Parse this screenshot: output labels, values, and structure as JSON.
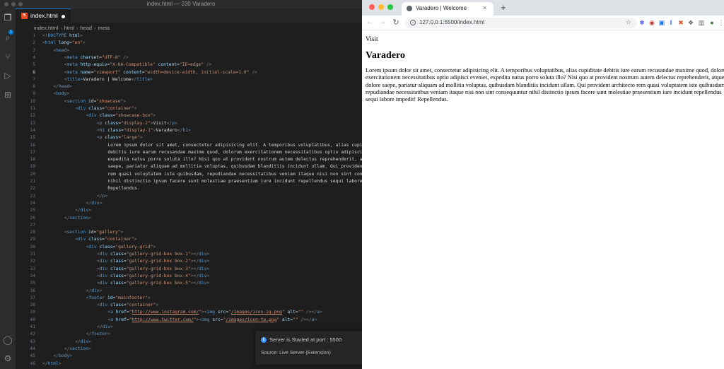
{
  "vscode": {
    "window_title": "index.html — 230 Varadero",
    "tab": {
      "icon": "html5-icon",
      "label": "index.html"
    },
    "breadcrumb": [
      "index.html",
      "html",
      "head",
      "meta"
    ],
    "current_line": 6,
    "notification": {
      "message": "Server is Started at port : 5500",
      "source": "Source: Live Server (Extension)"
    },
    "accent": "#0078d4"
  },
  "code_lines": [
    {
      "n": "1",
      "i": 0,
      "t": [
        [
          "pu",
          "<!"
        ],
        [
          "tg",
          "DOCTYPE"
        ],
        [
          "tx",
          " "
        ],
        [
          "at",
          "html"
        ],
        [
          "pu",
          ">"
        ]
      ]
    },
    {
      "n": "2",
      "i": 0,
      "t": [
        [
          "pu",
          "<"
        ],
        [
          "tg",
          "html"
        ],
        [
          "tx",
          " "
        ],
        [
          "at",
          "lang"
        ],
        [
          "tx",
          "="
        ],
        [
          "st",
          "\"en\""
        ],
        [
          "pu",
          ">"
        ]
      ]
    },
    {
      "n": "3",
      "i": 1,
      "t": [
        [
          "pu",
          "<"
        ],
        [
          "tg",
          "head"
        ],
        [
          "pu",
          ">"
        ]
      ]
    },
    {
      "n": "4",
      "i": 2,
      "t": [
        [
          "pu",
          "<"
        ],
        [
          "tg",
          "meta"
        ],
        [
          "tx",
          " "
        ],
        [
          "at",
          "charset"
        ],
        [
          "tx",
          "="
        ],
        [
          "st",
          "\"UTF-8\""
        ],
        [
          "tx",
          " "
        ],
        [
          "pu",
          "/>"
        ]
      ]
    },
    {
      "n": "5",
      "i": 2,
      "t": [
        [
          "pu",
          "<"
        ],
        [
          "tg",
          "meta"
        ],
        [
          "tx",
          " "
        ],
        [
          "at",
          "http-equiv"
        ],
        [
          "tx",
          "="
        ],
        [
          "st",
          "\"X-UA-Compatible\""
        ],
        [
          "tx",
          " "
        ],
        [
          "at",
          "content"
        ],
        [
          "tx",
          "="
        ],
        [
          "st",
          "\"IE=edge\""
        ],
        [
          "tx",
          " "
        ],
        [
          "pu",
          "/>"
        ]
      ]
    },
    {
      "n": "6",
      "i": 2,
      "t": [
        [
          "pu",
          "<"
        ],
        [
          "tg",
          "meta"
        ],
        [
          "tx",
          " "
        ],
        [
          "at",
          "name"
        ],
        [
          "tx",
          "="
        ],
        [
          "st",
          "\"viewport\""
        ],
        [
          "tx",
          " "
        ],
        [
          "at",
          "content"
        ],
        [
          "tx",
          "="
        ],
        [
          "st",
          "\"width=device-width, initial-scale=1.0\""
        ],
        [
          "tx",
          " "
        ],
        [
          "pu",
          "/>"
        ]
      ]
    },
    {
      "n": "7",
      "i": 2,
      "t": [
        [
          "pu",
          "<"
        ],
        [
          "tg",
          "title"
        ],
        [
          "pu",
          ">"
        ],
        [
          "tx",
          "Varadero | Welcome"
        ],
        [
          "pu",
          "</"
        ],
        [
          "tg",
          "title"
        ],
        [
          "pu",
          ">"
        ]
      ]
    },
    {
      "n": "8",
      "i": 1,
      "t": [
        [
          "pu",
          "</"
        ],
        [
          "tg",
          "head"
        ],
        [
          "pu",
          ">"
        ]
      ]
    },
    {
      "n": "9",
      "i": 1,
      "t": [
        [
          "pu",
          "<"
        ],
        [
          "tg",
          "body"
        ],
        [
          "pu",
          ">"
        ]
      ]
    },
    {
      "n": "10",
      "i": 2,
      "t": [
        [
          "pu",
          "<"
        ],
        [
          "tg",
          "section"
        ],
        [
          "tx",
          " "
        ],
        [
          "at",
          "id"
        ],
        [
          "tx",
          "="
        ],
        [
          "st",
          "\"showcase\""
        ],
        [
          "pu",
          ">"
        ]
      ]
    },
    {
      "n": "11",
      "i": 3,
      "t": [
        [
          "pu",
          "<"
        ],
        [
          "tg",
          "div"
        ],
        [
          "tx",
          " "
        ],
        [
          "at",
          "class"
        ],
        [
          "tx",
          "="
        ],
        [
          "st",
          "\"container\""
        ],
        [
          "pu",
          ">"
        ]
      ]
    },
    {
      "n": "12",
      "i": 4,
      "t": [
        [
          "pu",
          "<"
        ],
        [
          "tg",
          "div"
        ],
        [
          "tx",
          " "
        ],
        [
          "at",
          "class"
        ],
        [
          "tx",
          "="
        ],
        [
          "st",
          "\"showcase-box\""
        ],
        [
          "pu",
          ">"
        ]
      ]
    },
    {
      "n": "13",
      "i": 5,
      "t": [
        [
          "pu",
          "<"
        ],
        [
          "tg",
          "p"
        ],
        [
          "tx",
          " "
        ],
        [
          "at",
          "class"
        ],
        [
          "tx",
          "="
        ],
        [
          "st",
          "\"display-2\""
        ],
        [
          "pu",
          ">"
        ],
        [
          "tx",
          "Visit"
        ],
        [
          "pu",
          "</"
        ],
        [
          "tg",
          "p"
        ],
        [
          "pu",
          ">"
        ]
      ]
    },
    {
      "n": "14",
      "i": 5,
      "t": [
        [
          "pu",
          "<"
        ],
        [
          "tg",
          "h1"
        ],
        [
          "tx",
          " "
        ],
        [
          "at",
          "class"
        ],
        [
          "tx",
          "="
        ],
        [
          "st",
          "\"display-1\""
        ],
        [
          "pu",
          ">"
        ],
        [
          "tx",
          "Varadero"
        ],
        [
          "pu",
          "</"
        ],
        [
          "tg",
          "h1"
        ],
        [
          "pu",
          ">"
        ]
      ]
    },
    {
      "n": "15",
      "i": 5,
      "t": [
        [
          "pu",
          "<"
        ],
        [
          "tg",
          "p"
        ],
        [
          "tx",
          " "
        ],
        [
          "at",
          "class"
        ],
        [
          "tx",
          "="
        ],
        [
          "st",
          "\"large\""
        ],
        [
          "pu",
          ">"
        ]
      ]
    },
    {
      "n": "16",
      "i": 6,
      "t": [
        [
          "tx",
          "Lorem ipsum dolor sit amet, consectetur adipisicing elit. A temporibus voluptatibus, alias cupiditate"
        ]
      ]
    },
    {
      "n": "17",
      "i": 6,
      "t": [
        [
          "tx",
          "debitis iure earum recusandae maxime quod, dolorum exercitationem necessitatibus optio adipisci eveniet,"
        ]
      ]
    },
    {
      "n": "18",
      "i": 6,
      "t": [
        [
          "tx",
          "expedita natus porro soluta illo? Nisi quo at provident nostrum autem delectus reprehenderit, atque dolore"
        ]
      ]
    },
    {
      "n": "19",
      "i": 6,
      "t": [
        [
          "tx",
          "saepe, pariatur aliquam ad mollitia voluptas, quibusdam blanditiis incidunt ullam. Qui provident architecto"
        ]
      ]
    },
    {
      "n": "20",
      "i": 6,
      "t": [
        [
          "tx",
          "rem quasi voluptatem iste quibusdam, repudiandae necessitatibus veniam itaque nisi non sint consequuntur"
        ]
      ]
    },
    {
      "n": "21",
      "i": 6,
      "t": [
        [
          "tx",
          "nihil distinctio ipsum facere sunt molestiae praesentium iure incidunt repellendus sequi labore impedit!"
        ]
      ]
    },
    {
      "n": "22",
      "i": 6,
      "t": [
        [
          "tx",
          "Repellendus."
        ]
      ]
    },
    {
      "n": "23",
      "i": 5,
      "t": [
        [
          "pu",
          "</"
        ],
        [
          "tg",
          "p"
        ],
        [
          "pu",
          ">"
        ]
      ]
    },
    {
      "n": "24",
      "i": 4,
      "t": [
        [
          "pu",
          "</"
        ],
        [
          "tg",
          "div"
        ],
        [
          "pu",
          ">"
        ]
      ]
    },
    {
      "n": "25",
      "i": 3,
      "t": [
        [
          "pu",
          "</"
        ],
        [
          "tg",
          "div"
        ],
        [
          "pu",
          ">"
        ]
      ]
    },
    {
      "n": "26",
      "i": 2,
      "t": [
        [
          "pu",
          "</"
        ],
        [
          "tg",
          "section"
        ],
        [
          "pu",
          ">"
        ]
      ]
    },
    {
      "n": "27",
      "i": 0,
      "t": []
    },
    {
      "n": "28",
      "i": 2,
      "t": [
        [
          "pu",
          "<"
        ],
        [
          "tg",
          "section"
        ],
        [
          "tx",
          " "
        ],
        [
          "at",
          "id"
        ],
        [
          "tx",
          "="
        ],
        [
          "st",
          "\"gallery\""
        ],
        [
          "pu",
          ">"
        ]
      ]
    },
    {
      "n": "29",
      "i": 3,
      "t": [
        [
          "pu",
          "<"
        ],
        [
          "tg",
          "div"
        ],
        [
          "tx",
          " "
        ],
        [
          "at",
          "class"
        ],
        [
          "tx",
          "="
        ],
        [
          "st",
          "\"container\""
        ],
        [
          "pu",
          ">"
        ]
      ]
    },
    {
      "n": "30",
      "i": 4,
      "t": [
        [
          "pu",
          "<"
        ],
        [
          "tg",
          "div"
        ],
        [
          "tx",
          " "
        ],
        [
          "at",
          "class"
        ],
        [
          "tx",
          "="
        ],
        [
          "st",
          "\"gallery-grid\""
        ],
        [
          "pu",
          ">"
        ]
      ]
    },
    {
      "n": "31",
      "i": 5,
      "t": [
        [
          "pu",
          "<"
        ],
        [
          "tg",
          "div"
        ],
        [
          "tx",
          " "
        ],
        [
          "at",
          "class"
        ],
        [
          "tx",
          "="
        ],
        [
          "st",
          "\"gallery-grid-box box-1\""
        ],
        [
          "pu",
          "></"
        ],
        [
          "tg",
          "div"
        ],
        [
          "pu",
          ">"
        ]
      ]
    },
    {
      "n": "32",
      "i": 5,
      "t": [
        [
          "pu",
          "<"
        ],
        [
          "tg",
          "div"
        ],
        [
          "tx",
          " "
        ],
        [
          "at",
          "class"
        ],
        [
          "tx",
          "="
        ],
        [
          "st",
          "\"gallery-grid-box box-2\""
        ],
        [
          "pu",
          "></"
        ],
        [
          "tg",
          "div"
        ],
        [
          "pu",
          ">"
        ]
      ]
    },
    {
      "n": "33",
      "i": 5,
      "t": [
        [
          "pu",
          "<"
        ],
        [
          "tg",
          "div"
        ],
        [
          "tx",
          " "
        ],
        [
          "at",
          "class"
        ],
        [
          "tx",
          "="
        ],
        [
          "st",
          "\"gallery-grid-box box-3\""
        ],
        [
          "pu",
          "></"
        ],
        [
          "tg",
          "div"
        ],
        [
          "pu",
          ">"
        ]
      ]
    },
    {
      "n": "34",
      "i": 5,
      "t": [
        [
          "pu",
          "<"
        ],
        [
          "tg",
          "div"
        ],
        [
          "tx",
          " "
        ],
        [
          "at",
          "class"
        ],
        [
          "tx",
          "="
        ],
        [
          "st",
          "\"gallery-grid-box box-4\""
        ],
        [
          "pu",
          "></"
        ],
        [
          "tg",
          "div"
        ],
        [
          "pu",
          ">"
        ]
      ]
    },
    {
      "n": "35",
      "i": 5,
      "t": [
        [
          "pu",
          "<"
        ],
        [
          "tg",
          "div"
        ],
        [
          "tx",
          " "
        ],
        [
          "at",
          "class"
        ],
        [
          "tx",
          "="
        ],
        [
          "st",
          "\"gallery-grid-box box-5\""
        ],
        [
          "pu",
          "></"
        ],
        [
          "tg",
          "div"
        ],
        [
          "pu",
          ">"
        ]
      ]
    },
    {
      "n": "36",
      "i": 4,
      "t": [
        [
          "pu",
          "</"
        ],
        [
          "tg",
          "div"
        ],
        [
          "pu",
          ">"
        ]
      ]
    },
    {
      "n": "37",
      "i": 4,
      "t": [
        [
          "pu",
          "<"
        ],
        [
          "tg",
          "footer"
        ],
        [
          "tx",
          " "
        ],
        [
          "at",
          "id"
        ],
        [
          "tx",
          "="
        ],
        [
          "st",
          "\"mainfooter\""
        ],
        [
          "pu",
          ">"
        ]
      ]
    },
    {
      "n": "38",
      "i": 5,
      "t": [
        [
          "pu",
          "<"
        ],
        [
          "tg",
          "div"
        ],
        [
          "tx",
          " "
        ],
        [
          "at",
          "class"
        ],
        [
          "tx",
          "="
        ],
        [
          "st",
          "\"container\""
        ],
        [
          "pu",
          ">"
        ]
      ]
    },
    {
      "n": "39",
      "i": 6,
      "t": [
        [
          "pu",
          "<"
        ],
        [
          "tg",
          "a"
        ],
        [
          "tx",
          " "
        ],
        [
          "at",
          "href"
        ],
        [
          "tx",
          "="
        ],
        [
          "st",
          "\""
        ],
        [
          "lk",
          "http://www.instagram.com/"
        ],
        [
          "st",
          "\""
        ],
        [
          "pu",
          "><"
        ],
        [
          "tg",
          "img"
        ],
        [
          "tx",
          " "
        ],
        [
          "at",
          "src"
        ],
        [
          "tx",
          "="
        ],
        [
          "st",
          "\""
        ],
        [
          "lk",
          "/images/icon-ig.png"
        ],
        [
          "st",
          "\""
        ],
        [
          "tx",
          " "
        ],
        [
          "at",
          "alt"
        ],
        [
          "tx",
          "="
        ],
        [
          "st",
          "\"\""
        ],
        [
          "tx",
          " "
        ],
        [
          "pu",
          "/></"
        ],
        [
          "tg",
          "a"
        ],
        [
          "pu",
          ">"
        ]
      ]
    },
    {
      "n": "40",
      "i": 6,
      "t": [
        [
          "pu",
          "<"
        ],
        [
          "tg",
          "a"
        ],
        [
          "tx",
          " "
        ],
        [
          "at",
          "href"
        ],
        [
          "tx",
          "="
        ],
        [
          "st",
          "\""
        ],
        [
          "lk",
          "http://www.twitter.com/"
        ],
        [
          "st",
          "\""
        ],
        [
          "pu",
          "><"
        ],
        [
          "tg",
          "img"
        ],
        [
          "tx",
          " "
        ],
        [
          "at",
          "src"
        ],
        [
          "tx",
          "="
        ],
        [
          "st",
          "\""
        ],
        [
          "lk",
          "/images/icon-tw.png"
        ],
        [
          "st",
          "\""
        ],
        [
          "tx",
          " "
        ],
        [
          "at",
          "alt"
        ],
        [
          "tx",
          "="
        ],
        [
          "st",
          "\"\""
        ],
        [
          "tx",
          " "
        ],
        [
          "pu",
          "/></"
        ],
        [
          "tg",
          "a"
        ],
        [
          "pu",
          ">"
        ]
      ]
    },
    {
      "n": "41",
      "i": 5,
      "t": [
        [
          "pu",
          "</"
        ],
        [
          "tg",
          "div"
        ],
        [
          "pu",
          ">"
        ]
      ]
    },
    {
      "n": "42",
      "i": 4,
      "t": [
        [
          "pu",
          "</"
        ],
        [
          "tg",
          "footer"
        ],
        [
          "pu",
          ">"
        ]
      ]
    },
    {
      "n": "43",
      "i": 3,
      "t": [
        [
          "pu",
          "</"
        ],
        [
          "tg",
          "div"
        ],
        [
          "pu",
          ">"
        ]
      ]
    },
    {
      "n": "44",
      "i": 2,
      "t": [
        [
          "pu",
          "</"
        ],
        [
          "tg",
          "section"
        ],
        [
          "pu",
          ">"
        ]
      ]
    },
    {
      "n": "45",
      "i": 1,
      "t": [
        [
          "pu",
          "</"
        ],
        [
          "tg",
          "body"
        ],
        [
          "pu",
          ">"
        ]
      ]
    },
    {
      "n": "46",
      "i": 0,
      "t": [
        [
          "pu",
          "</"
        ],
        [
          "tg",
          "html"
        ],
        [
          "pu",
          ">"
        ]
      ]
    }
  ],
  "browser": {
    "tab_title": "Varadero | Welcome",
    "tab_close": "×",
    "new_tab": "+",
    "url": "127.0.0.1:5500/index.html",
    "back": "←",
    "forward": "→",
    "reload": "↻",
    "page": {
      "visit": "Visit",
      "heading": "Varadero",
      "paragraph": "Lorem ipsum dolor sit amet, consectetur adipisicing elit. A temporibus voluptatibus, alias cupiditate debitis iure earum recusandae maxime quod, dolorum exercitationem necessitatibus optio adipisci eveniet, expedita natus porro soluta illo? Nisi quo at provident nostrum autem delectus reprehenderit, atque dolore saepe, pariatur aliquam ad mollitia voluptas, quibusdam blanditiis incidunt ullam. Qui provident architecto rem quasi voluptatem iste quibusdam, repudiandae necessitatibus veniam itaque nisi non sint consequuntur nihil distinctio ipsum facere sunt molestiae praesentium iure incidunt repellendus sequi labore impedit! Repellendus."
    }
  }
}
